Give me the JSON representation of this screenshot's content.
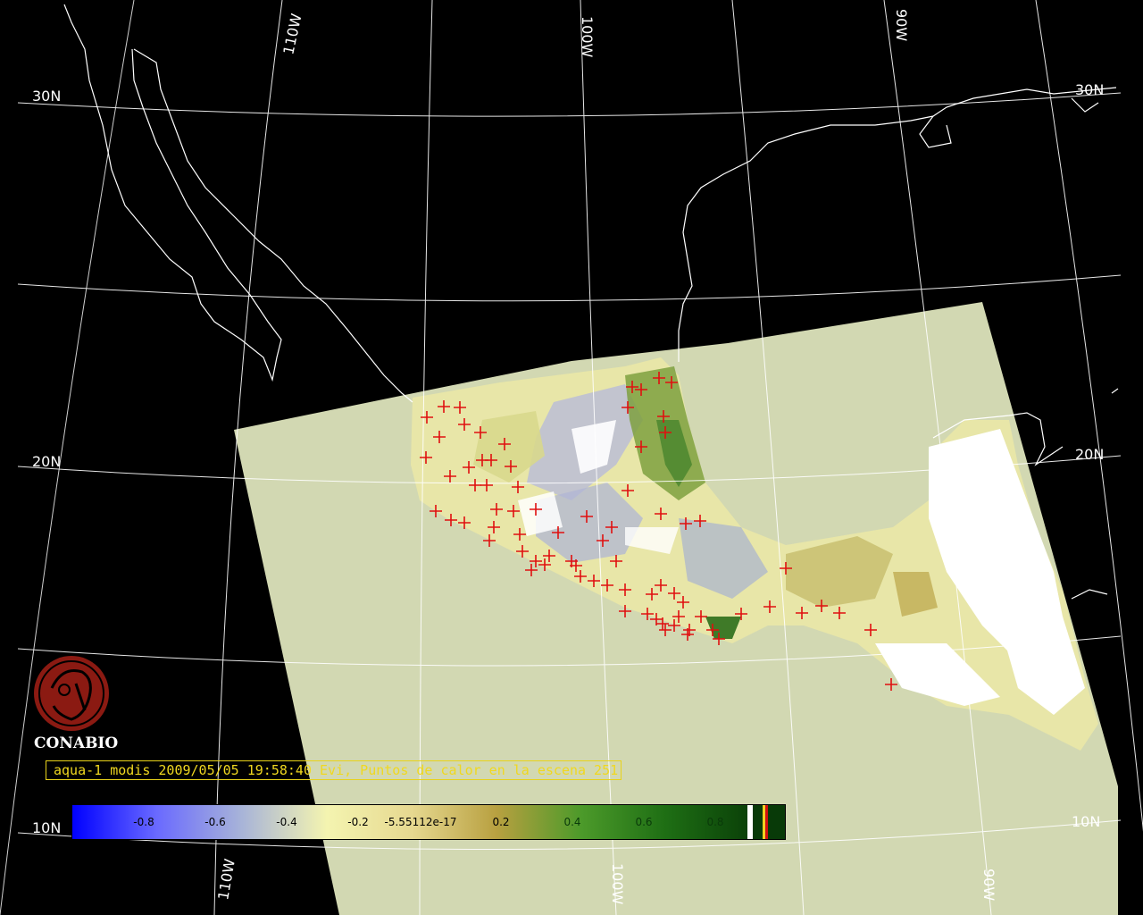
{
  "map": {
    "graticule_labels": {
      "lat_30": "30N",
      "lat_30_right": "30N",
      "lat_20": "20N",
      "lat_20_right": "20N",
      "lat_10": "10N",
      "lat_10_right": "10N",
      "lon_110_top": "110W",
      "lon_100_top": "100W",
      "lon_90_top": "90W",
      "lon_110_bottom": "110W",
      "lon_100_bottom": "100W",
      "lon_90_bottom": "90W"
    },
    "colors": {
      "background": "#000000",
      "swath": "#d2d8b2",
      "coastline": "#ffffff",
      "grid": "#ffffff",
      "hotspot": "#e01010"
    }
  },
  "logo": {
    "text": "CONABIO",
    "color": "#8b1a12"
  },
  "caption": {
    "text": "aqua-1 modis 2009/05/05 19:58:40 Evi, Puntos de calor en la escena 251"
  },
  "colorbar": {
    "ticks": [
      "-0.8",
      "-0.6",
      "-0.4",
      "-0.2",
      "-5.55112e-17",
      "0.2",
      "0.4",
      "0.6",
      "0.8"
    ],
    "stops": [
      "#0000ff",
      "#6a6aff",
      "#a8b4d8",
      "#f4f4b0",
      "#e6d890",
      "#b8a040",
      "#4c9a2a",
      "#1e6e14",
      "#0a4008"
    ]
  }
}
